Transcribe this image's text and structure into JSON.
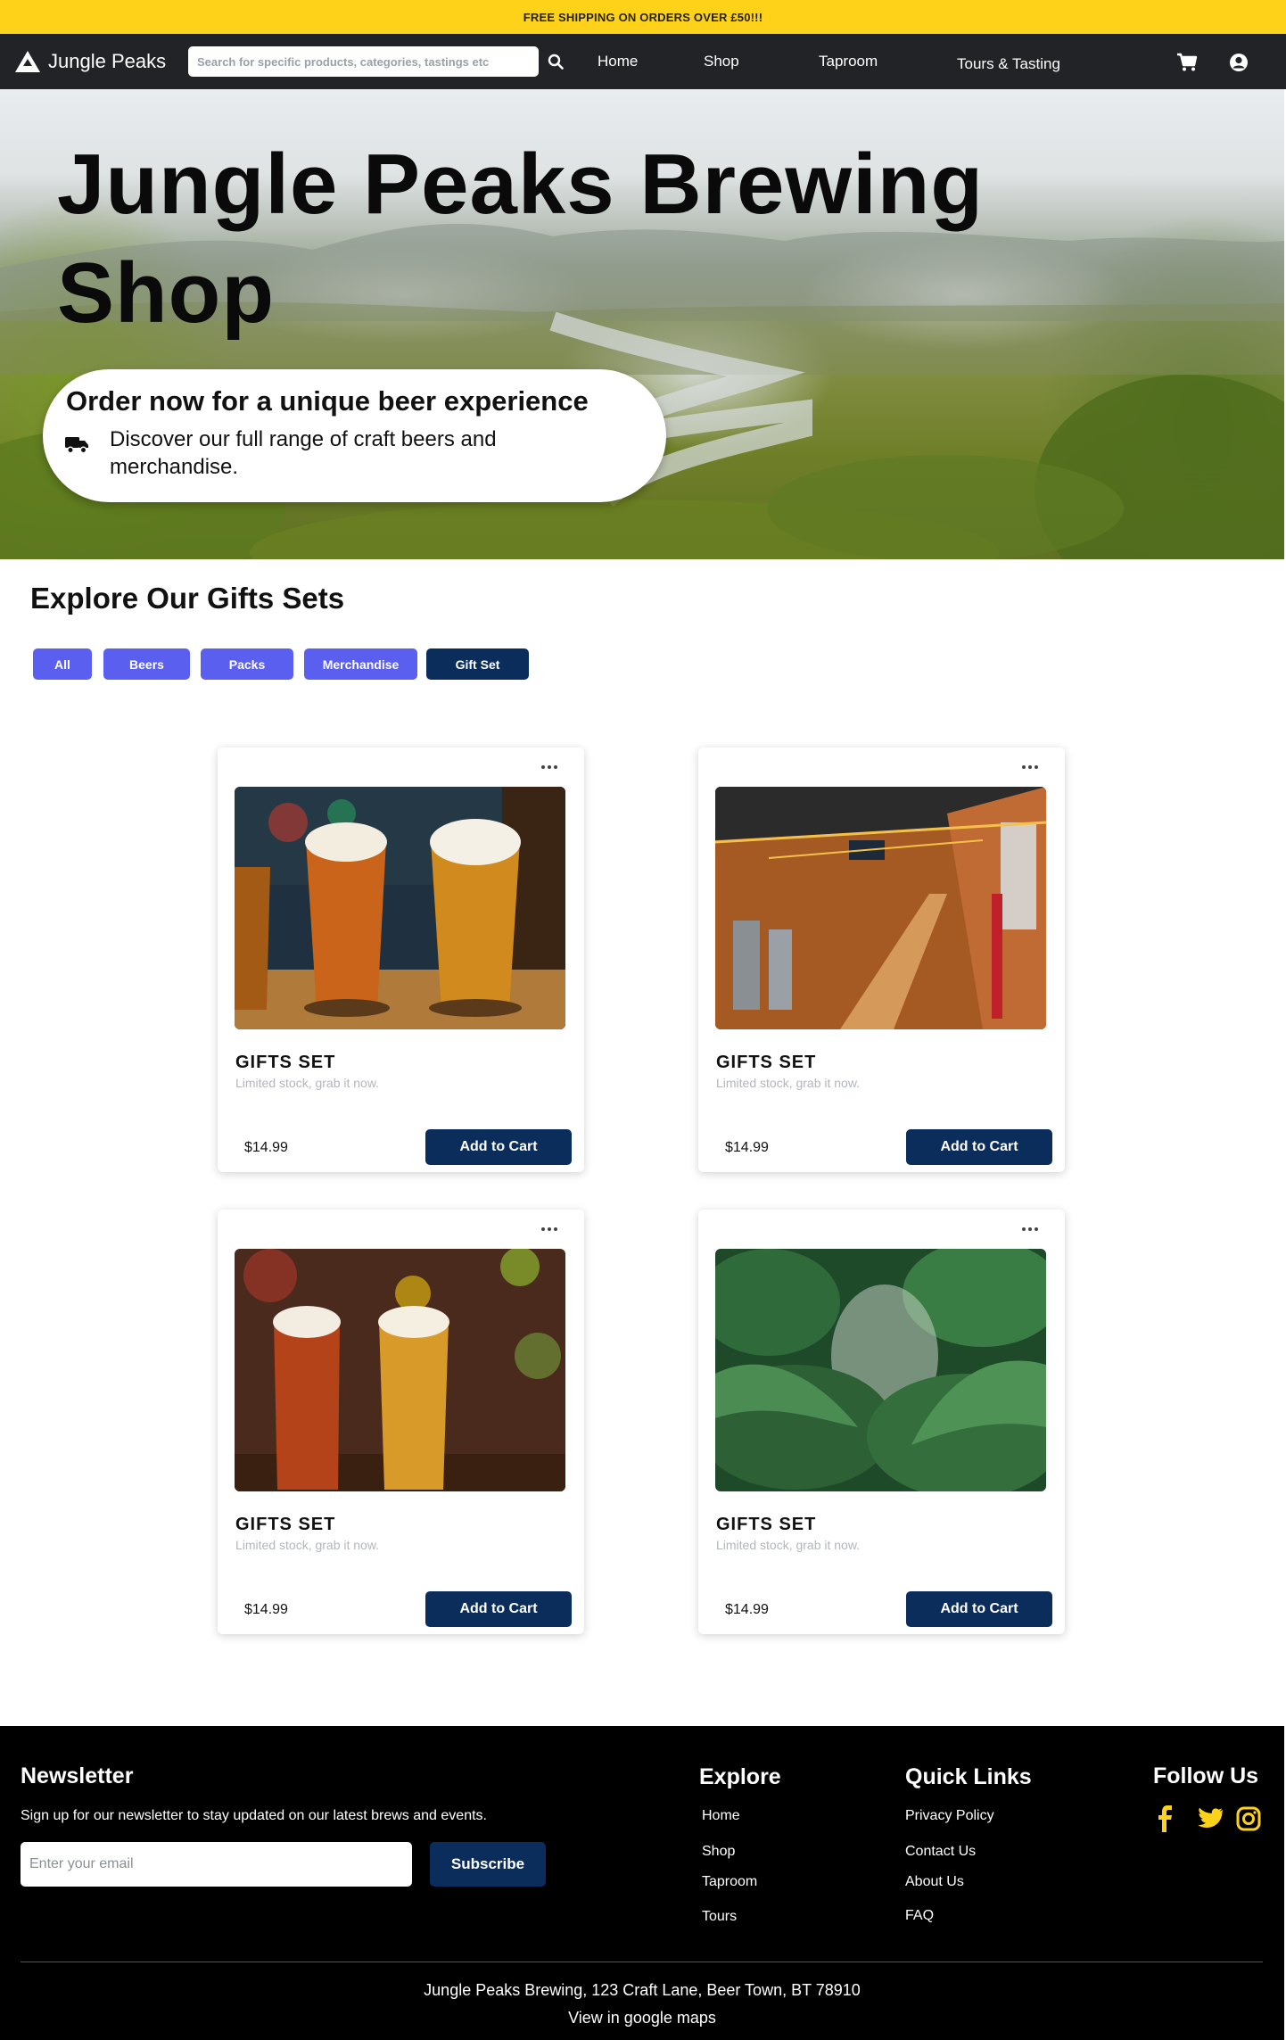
{
  "promo": {
    "text": "FREE SHIPPING ON ORDERS OVER £50!!!"
  },
  "nav": {
    "brand": "Jungle Peaks",
    "search_placeholder": "Search for specific products, categories, tastings etc",
    "links": [
      "Home",
      "Shop",
      "Taproom",
      "Tours & Tasting"
    ],
    "icons": [
      "search-icon",
      "cart-icon",
      "user-icon"
    ]
  },
  "hero": {
    "title": "Jungle Peaks Brewing Shop",
    "pill_title": "Order now for a unique beer experience",
    "pill_text": "Discover our full range of craft beers and merchandise.",
    "pill_icon": "truck-icon"
  },
  "gifts": {
    "title": "Explore Our Gifts Sets",
    "filters": [
      "All",
      "Beers",
      "Packs",
      "Merchandise",
      "Gift Set"
    ],
    "active_filter": "Gift Set",
    "add_label": "Add to Cart",
    "products": [
      {
        "title": "GIFTS SET",
        "subtitle": "Limited stock, grab it now.",
        "price": "$14.99",
        "image": "beer flight glasses"
      },
      {
        "title": "GIFTS SET",
        "subtitle": "Limited stock, grab it now.",
        "price": "$14.99",
        "image": "taproom interior"
      },
      {
        "title": "GIFTS SET",
        "subtitle": "Limited stock, grab it now.",
        "price": "$14.99",
        "image": "two pints of beer"
      },
      {
        "title": "GIFTS SET",
        "subtitle": "Limited stock, grab it now.",
        "price": "$14.99",
        "image": "jungle plants"
      }
    ]
  },
  "footer": {
    "newsletter_title": "Newsletter",
    "newsletter_text": "Sign up for our newsletter to stay updated on our latest brews and events.",
    "email_placeholder": "Enter your email",
    "subscribe_label": "Subscribe",
    "explore_title": "Explore",
    "explore_links": [
      "Home",
      "Shop",
      "Taproom",
      "Tours"
    ],
    "quick_title": "Quick Links",
    "quick_links": [
      "Privacy Policy",
      "Contact Us",
      "About Us",
      "FAQ"
    ],
    "follow_title": "Follow Us",
    "social_icons": [
      "facebook-icon",
      "twitter-icon",
      "instagram-icon"
    ],
    "address": "Jungle Peaks Brewing, 123 Craft Lane, Beer Town, BT 78910",
    "maps_link": "View in google maps"
  },
  "colors": {
    "promo": "#ffd21a",
    "nav": "#222326",
    "filter": "#5b5ff0",
    "filter_active": "#0b2d5c",
    "button": "#0b2d5c",
    "social": "#ffd21a"
  }
}
